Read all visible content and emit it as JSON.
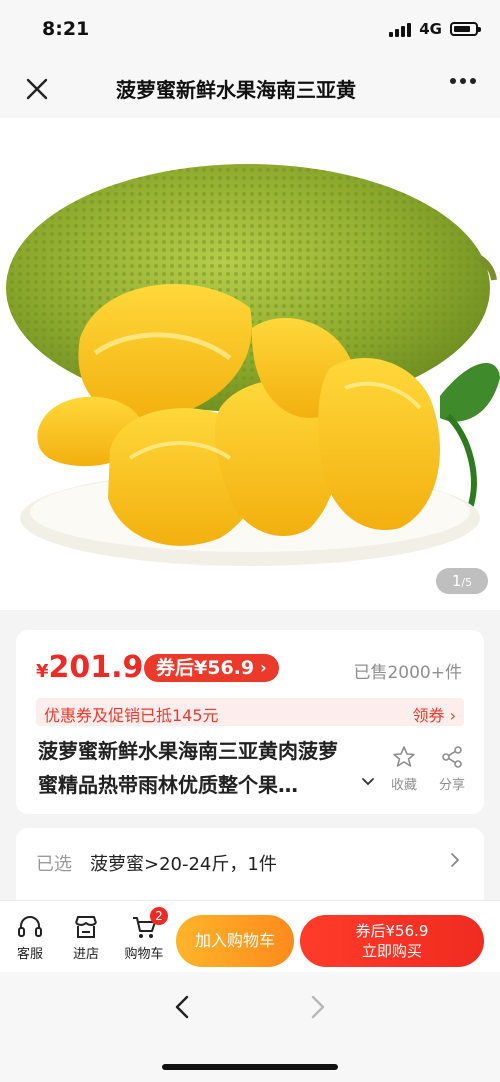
{
  "status": {
    "time": "8:21",
    "network": "4G"
  },
  "nav": {
    "title": "菠萝蜜新鲜水果海南三亚黄"
  },
  "hero": {
    "pager_current": "1",
    "pager_total": "/5"
  },
  "product": {
    "currency": "¥",
    "price": "201.9",
    "coupon_price_label": "券后¥56.9",
    "sold": "已售2000+件",
    "promo_text": "优惠券及促销已抵145元",
    "promo_action": "领券 ›",
    "title": "菠萝蜜新鲜水果海南三亚黄肉菠萝蜜精品热带雨林优质整个果…",
    "favorite_label": "收藏",
    "share_label": "分享"
  },
  "selection": {
    "label": "已选",
    "value": "菠萝蜜>20-24斤，1件"
  },
  "bottom": {
    "service_label": "客服",
    "store_label": "进店",
    "cart_label": "购物车",
    "cart_count": "2",
    "add_to_cart": "加入购物车",
    "buy_line1": "券后¥56.9",
    "buy_line2": "立即购买"
  },
  "colors": {
    "accent_red": "#ee2a24",
    "accent_orange": "#ff9a22"
  }
}
